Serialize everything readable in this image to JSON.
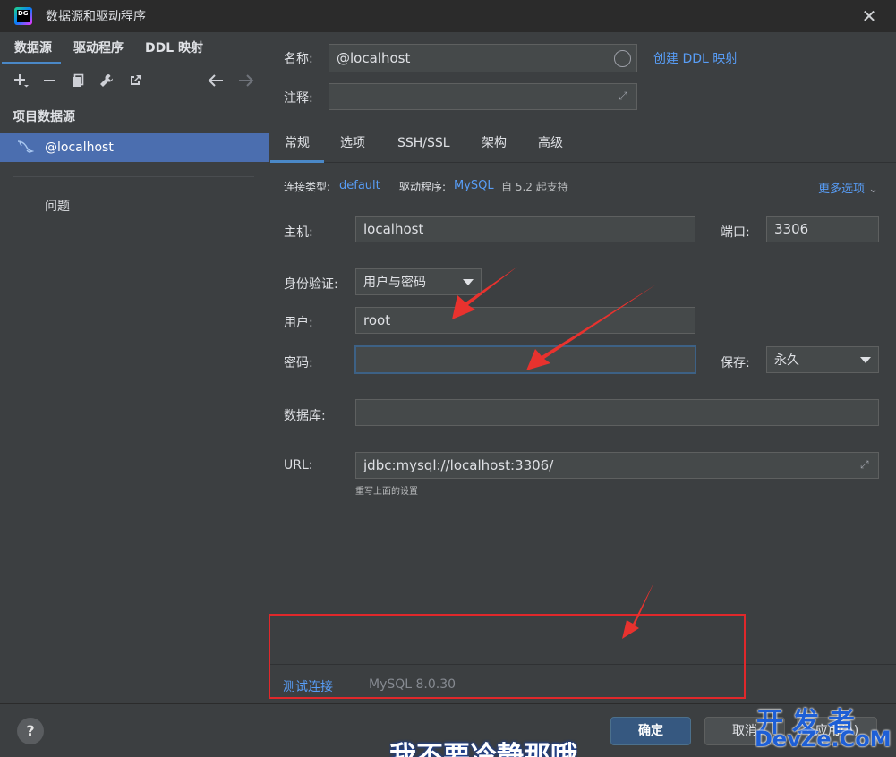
{
  "window": {
    "title": "数据源和驱动程序"
  },
  "left": {
    "tabs": [
      "数据源",
      "驱动程序",
      "DDL 映射"
    ],
    "section": "项目数据源",
    "datasource": "@localhost",
    "problems": "问题"
  },
  "right": {
    "name_label": "名称:",
    "name_value": "@localhost",
    "create_ddl_link": "创建 DDL 映射",
    "comment_label": "注释:",
    "comment_value": "",
    "tabs": [
      "常规",
      "选项",
      "SSH/SSL",
      "架构",
      "高级"
    ],
    "conn_type_label": "连接类型:",
    "conn_type_value": "default",
    "driver_label": "驱动程序:",
    "driver_value": "MySQL",
    "driver_note": "自 5.2 起支持",
    "more_options": "更多选项",
    "host_label": "主机:",
    "host_value": "localhost",
    "port_label": "端口:",
    "port_value": "3306",
    "auth_label": "身份验证:",
    "auth_value": "用户与密码",
    "user_label": "用户:",
    "user_value": "root",
    "password_label": "密码:",
    "password_value": "",
    "save_label": "保存:",
    "save_value": "永久",
    "database_label": "数据库:",
    "database_value": "",
    "url_label": "URL:",
    "url_value": "jdbc:mysql://localhost:3306/",
    "url_hint": "重写上面的设置",
    "test_connection": "测试连接",
    "server_version": "MySQL 8.0.30"
  },
  "footer": {
    "help": "?",
    "ok": "确定",
    "cancel": "取消",
    "apply": "应用(A)"
  },
  "overlay": {
    "watermark_top": "开发者",
    "watermark_bottom": "DevZe.CoM",
    "subtitle": "我不要冷静那哦"
  },
  "colors": {
    "accent": "#4a88c7",
    "link": "#589df6",
    "selection": "#4b6eaf",
    "annotation": "#e0282b"
  }
}
